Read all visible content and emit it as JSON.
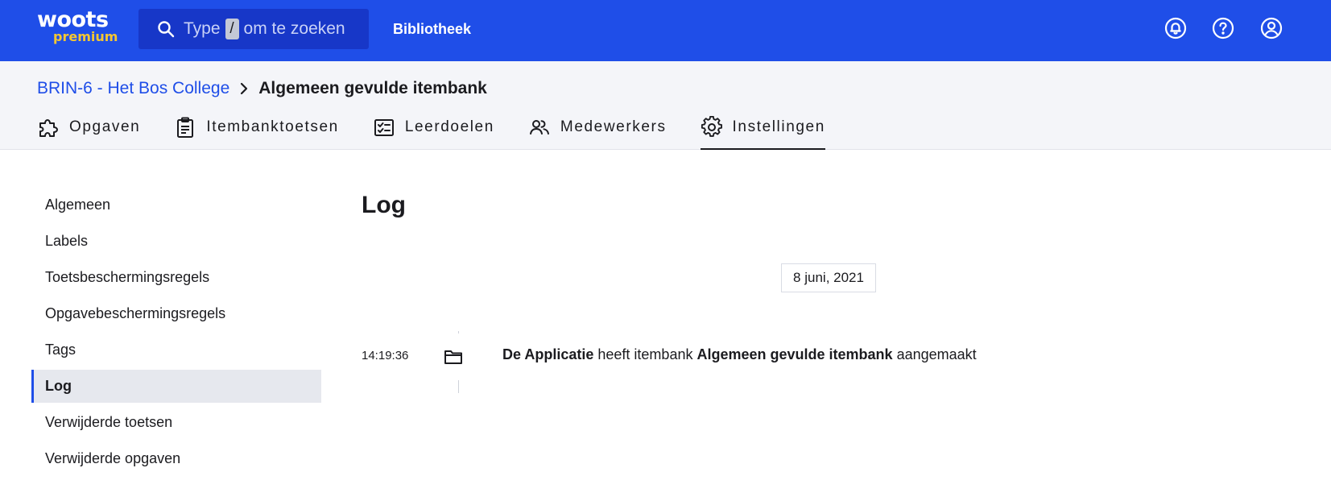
{
  "brand": {
    "name": "woots",
    "tier": "premium"
  },
  "colors": {
    "primary": "#1f4ee8",
    "accent": "#f6c731"
  },
  "search": {
    "prefix": "Type",
    "key": "/",
    "suffix": "om te zoeken"
  },
  "topnav": {
    "library": "Bibliotheek"
  },
  "topicons": [
    "notification-bell-icon",
    "help-icon",
    "account-icon"
  ],
  "breadcrumb": {
    "parent": "BRIN-6 - Het Bos College",
    "current": "Algemeen gevulde itembank"
  },
  "tabs": [
    {
      "label": "Opgaven",
      "icon": "puzzle-icon"
    },
    {
      "label": "Itembanktoetsen",
      "icon": "clipboard-icon"
    },
    {
      "label": "Leerdoelen",
      "icon": "checklist-icon"
    },
    {
      "label": "Medewerkers",
      "icon": "people-icon"
    },
    {
      "label": "Instellingen",
      "icon": "gear-icon",
      "active": true
    }
  ],
  "sidebar": {
    "items": [
      {
        "label": "Algemeen"
      },
      {
        "label": "Labels"
      },
      {
        "label": "Toetsbeschermingsregels"
      },
      {
        "label": "Opgavebeschermingsregels"
      },
      {
        "label": "Tags"
      },
      {
        "label": "Log",
        "active": true
      },
      {
        "label": "Verwijderde toetsen"
      },
      {
        "label": "Verwijderde opgaven"
      }
    ]
  },
  "main": {
    "title": "Log",
    "date": "8 juni, 2021",
    "entries": [
      {
        "time": "14:19:36",
        "icon": "folder-icon",
        "actor": "De Applicatie",
        "action": "heeft itembank",
        "object": "Algemeen gevulde itembank",
        "verb": "aangemaakt"
      }
    ]
  }
}
